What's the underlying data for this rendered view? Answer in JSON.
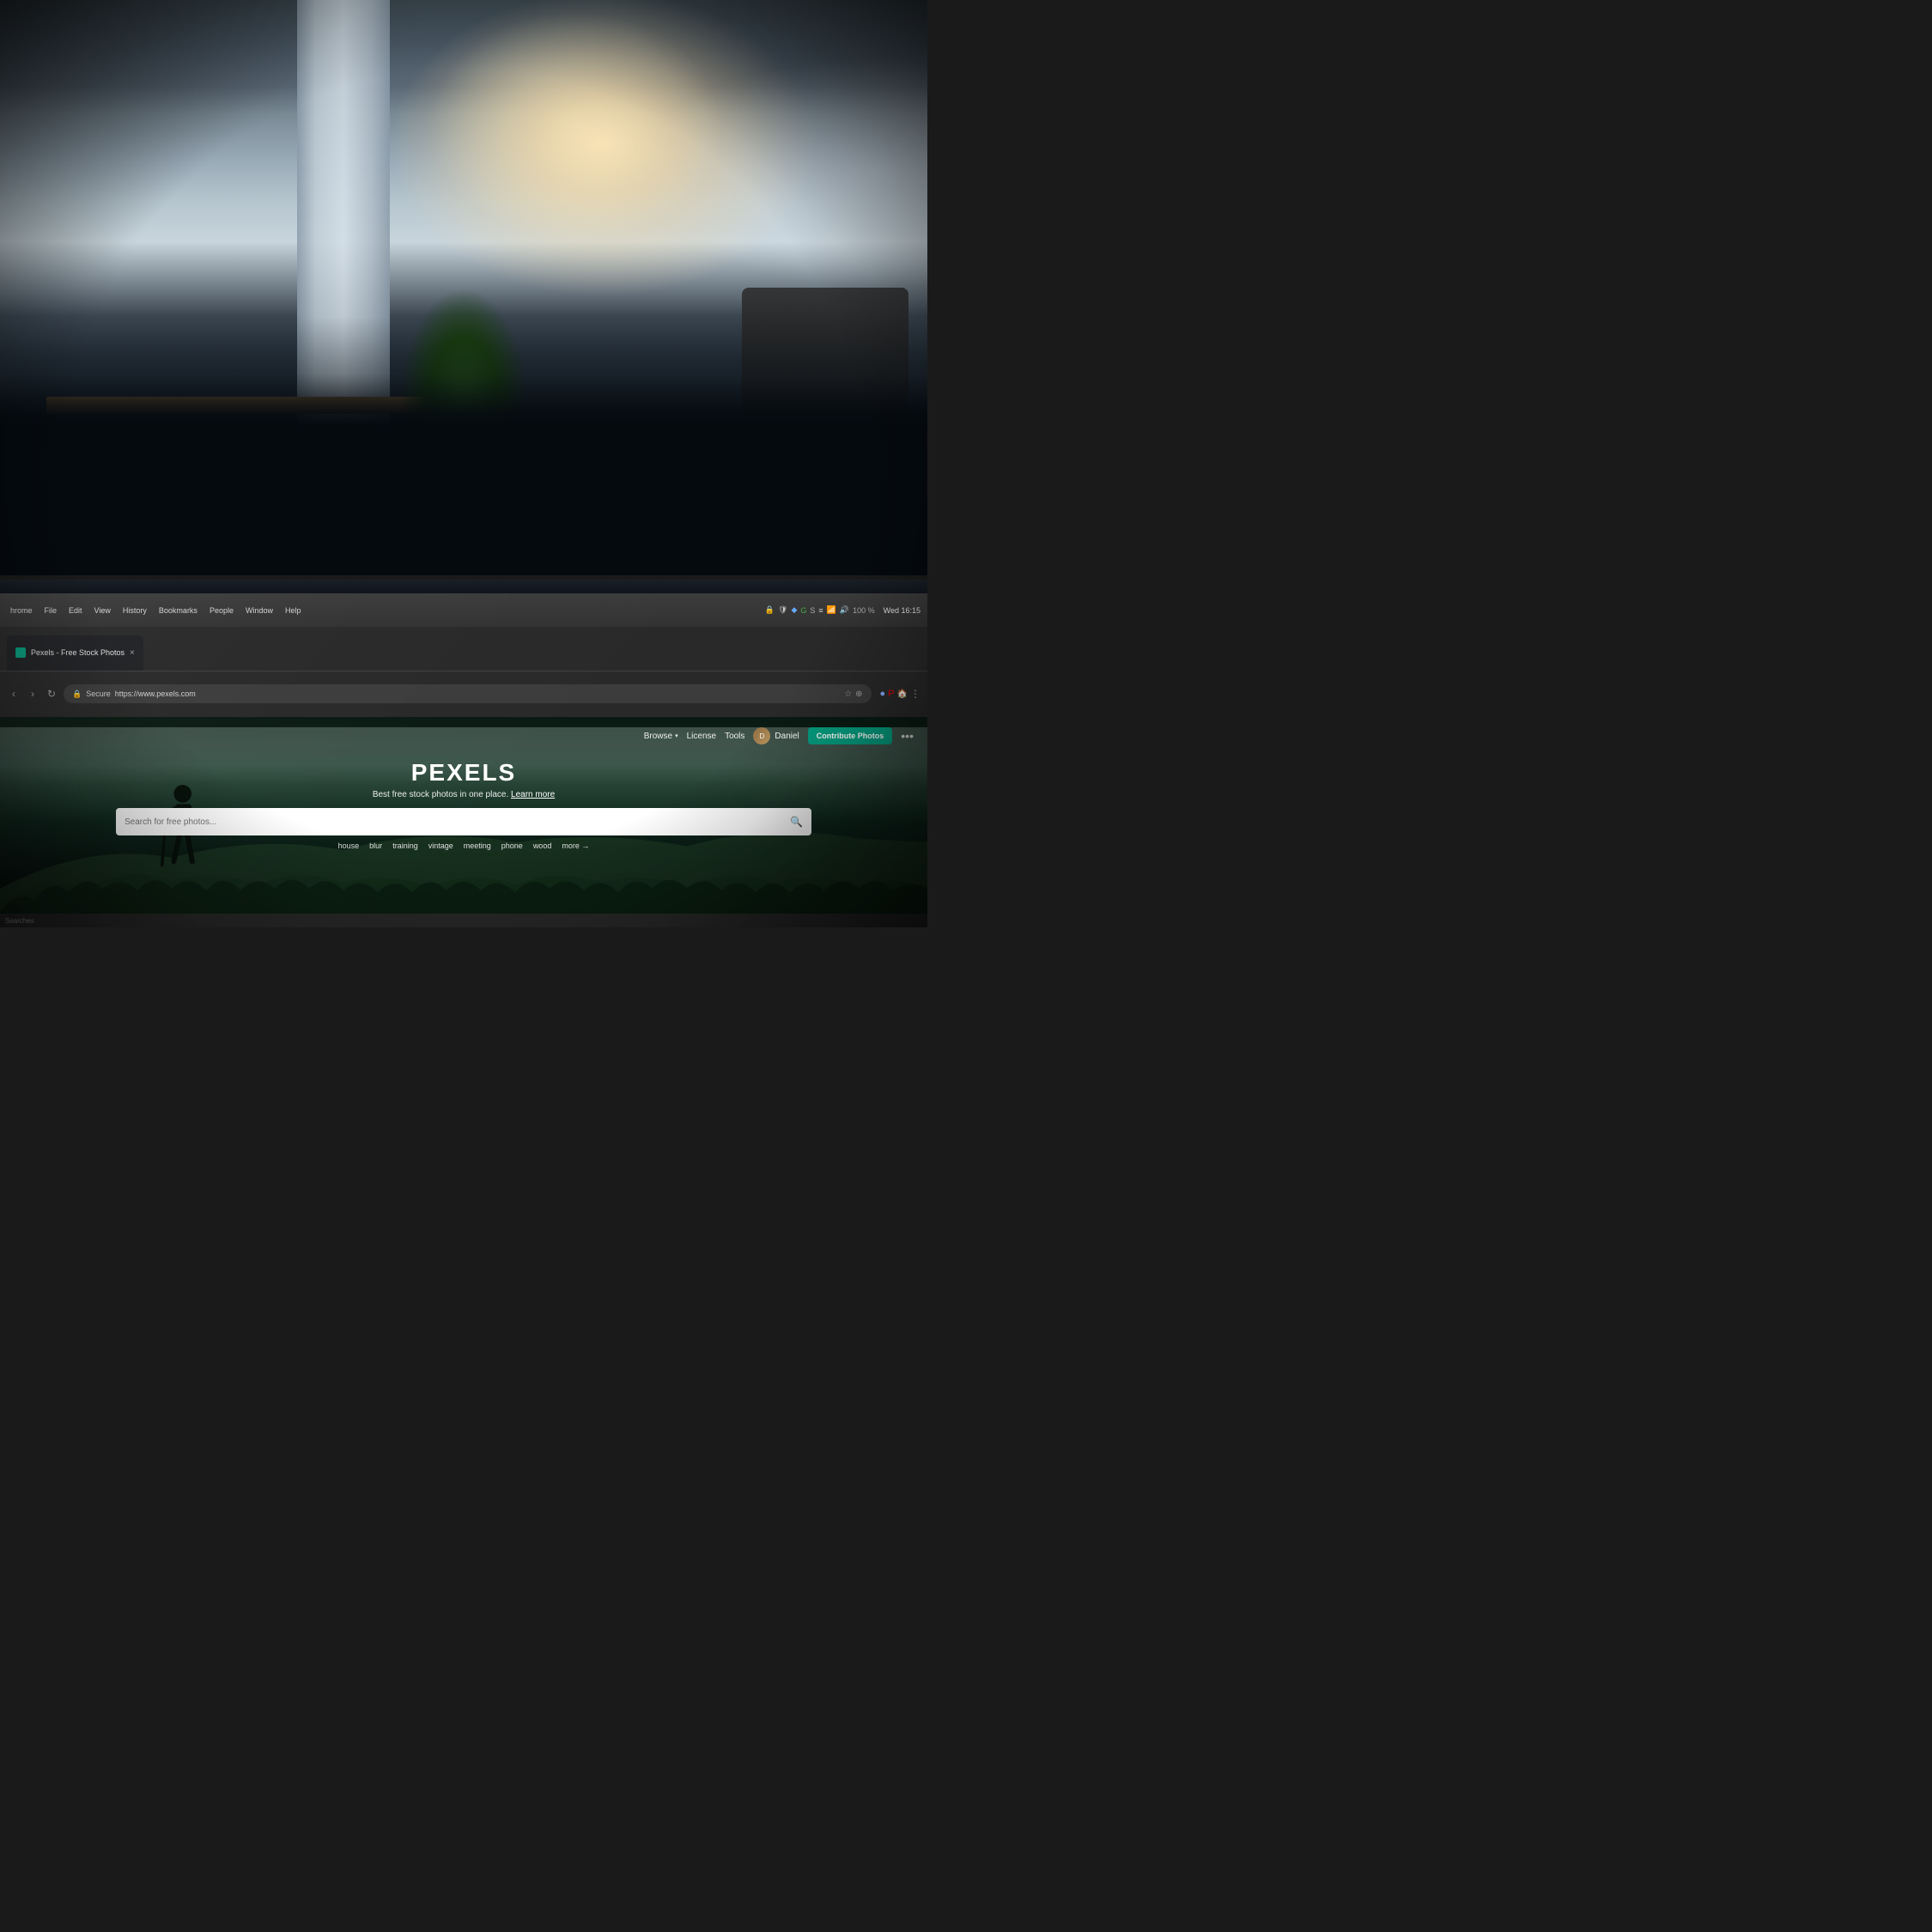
{
  "photo": {
    "description": "Office interior background photo, blurred",
    "alt": "Modern office with pillar, plants, windows with sunlight"
  },
  "browser": {
    "menu": {
      "items": [
        "hrome",
        "File",
        "Edit",
        "View",
        "History",
        "Bookmarks",
        "People",
        "Window",
        "Help"
      ]
    },
    "clock": "Wed 16:15",
    "battery": "100 %",
    "tab": {
      "title": "Pexels - Free Stock Photos",
      "favicon_color": "#05a081"
    },
    "address": {
      "secure_label": "Secure",
      "url": "https://www.pexels.com",
      "close_symbol": "×"
    },
    "status_bar": {
      "text": "Searches"
    }
  },
  "pexels": {
    "nav": {
      "browse_label": "Browse",
      "license_label": "License",
      "tools_label": "Tools",
      "user_name": "Daniel",
      "contribute_label": "Contribute Photos",
      "more_symbol": "•••"
    },
    "hero": {
      "logo": "PEXELS",
      "tagline": "Best free stock photos in one place.",
      "learn_more": "Learn more",
      "search_placeholder": "Search for free photos..."
    },
    "tags": [
      "house",
      "blur",
      "training",
      "vintage",
      "meeting",
      "phone",
      "wood"
    ],
    "more_label": "more →"
  }
}
